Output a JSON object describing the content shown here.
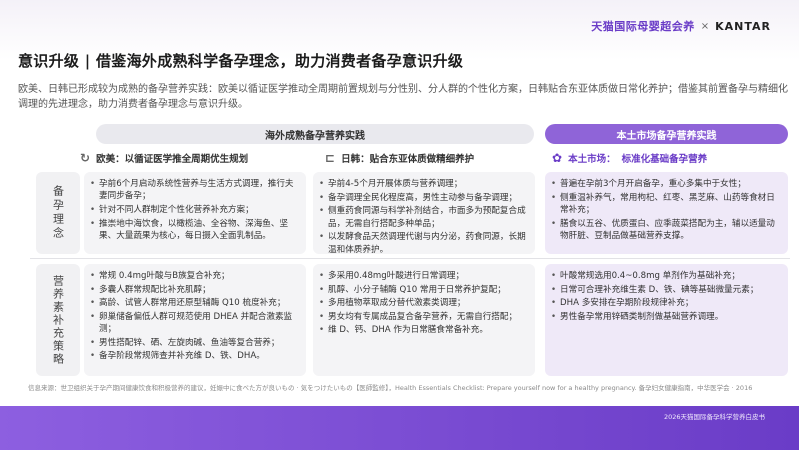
{
  "brand": {
    "tmall": "天猫国际母婴超会养",
    "separator": "×",
    "kantar": "KANTAR"
  },
  "title": "意识升级 | 借鉴海外成熟科学备孕理念，助力消费者备孕意识升级",
  "subtitle": "欧美、日韩已形成较为成熟的备孕营养实践：欧美以循证医学推动全周期前置规划与分性别、分人群的个性化方案，日韩贴合东亚体质做日常化养护；借鉴其前置备孕与精细化调理的先进理念，助力消费者备孕理念与意识升级。",
  "columns": {
    "overseas": "海外成熟备孕营养实践",
    "local": "本土市场备孕营养实践"
  },
  "subheads": {
    "western": "欧美：以循证医学推全周期优生规划",
    "asia": "日韩：贴合东亚体质做精细养护",
    "local_prefix": "本土市场：",
    "local_label": "标准化基础备孕营养"
  },
  "rows": {
    "concept": "备孕理念",
    "nutrition": "营养素补充策略"
  },
  "cells": {
    "western_concept": [
      "孕前6个月启动系统性营养与生活方式调理，推行夫妻同步备孕；",
      "针对不同人群制定个性化营养补充方案；",
      "推崇地中海饮食，以橄榄油、全谷物、深海鱼、坚果、大量蔬果为核心，每日摄入全面乳制品。"
    ],
    "asia_concept": [
      "孕前4-5个月开展体质与营养调理；",
      "备孕调理全民化程度高，男性主动参与备孕调理；",
      "侧重药食同源与科学补剂结合，市面多为预配复合成品，无需自行搭配多种单品；",
      "以发酵食品天然调理代谢与内分泌，药食同源，长期温和体质养护。"
    ],
    "local_concept": [
      "普遍在孕前3个月开启备孕，重心多集中于女性；",
      "侧重温补养气，常用枸杞、红枣、黑芝麻、山药等食材日常补充；",
      "膳食以五谷、优质蛋白、应季蔬菜搭配为主，辅以适量动物肝脏、豆制品做基础营养支撑。"
    ],
    "western_nutrition": [
      "常规 0.4mg叶酸与B族复合补充；",
      "多囊人群常规配比补充肌醇；",
      "高龄、试管人群常用还原型辅酶 Q10 梳度补充；",
      "卵巢储备偏低人群可规范使用 DHEA 并配合激素监测；",
      "男性搭配锌、硒、左旋肉碱、鱼油等复合营养；",
      "备孕阶段常规筛查并补充维 D、铁、DHA。"
    ],
    "asia_nutrition": [
      "多采用0.48mg叶酸进行日常调理；",
      "肌醇、小分子辅酶 Q10 常用于日常养护复配；",
      "多用植物萃取成分替代激素类调理；",
      "男女均有专属成品复合备孕营养，无需自行搭配；",
      "维 D、钙、DHA 作为日常膳食常备补充。"
    ],
    "local_nutrition": [
      "叶酸常规选用0.4~0.8mg 单剂作为基础补充；",
      "日常可合理补充维生素 D、铁、碘等基础微量元素；",
      "DHA 多安排在孕期阶段规律补充；",
      "男性备孕常用锌硒类制剂做基础营养调理。"
    ]
  },
  "source": "信息来源：世卫组织关于孕产期间健康饮食和积极营养的建议，妊娠中に食べた方が良いもの · 気をつけたいもの【医師監修】，Health Essentials Checklist: Prepare yourself now for a healthy pregnancy. 备孕妇女健康指南，中华医学会 · 2016",
  "footer": "2026天猫国际备孕科学营养白皮书"
}
